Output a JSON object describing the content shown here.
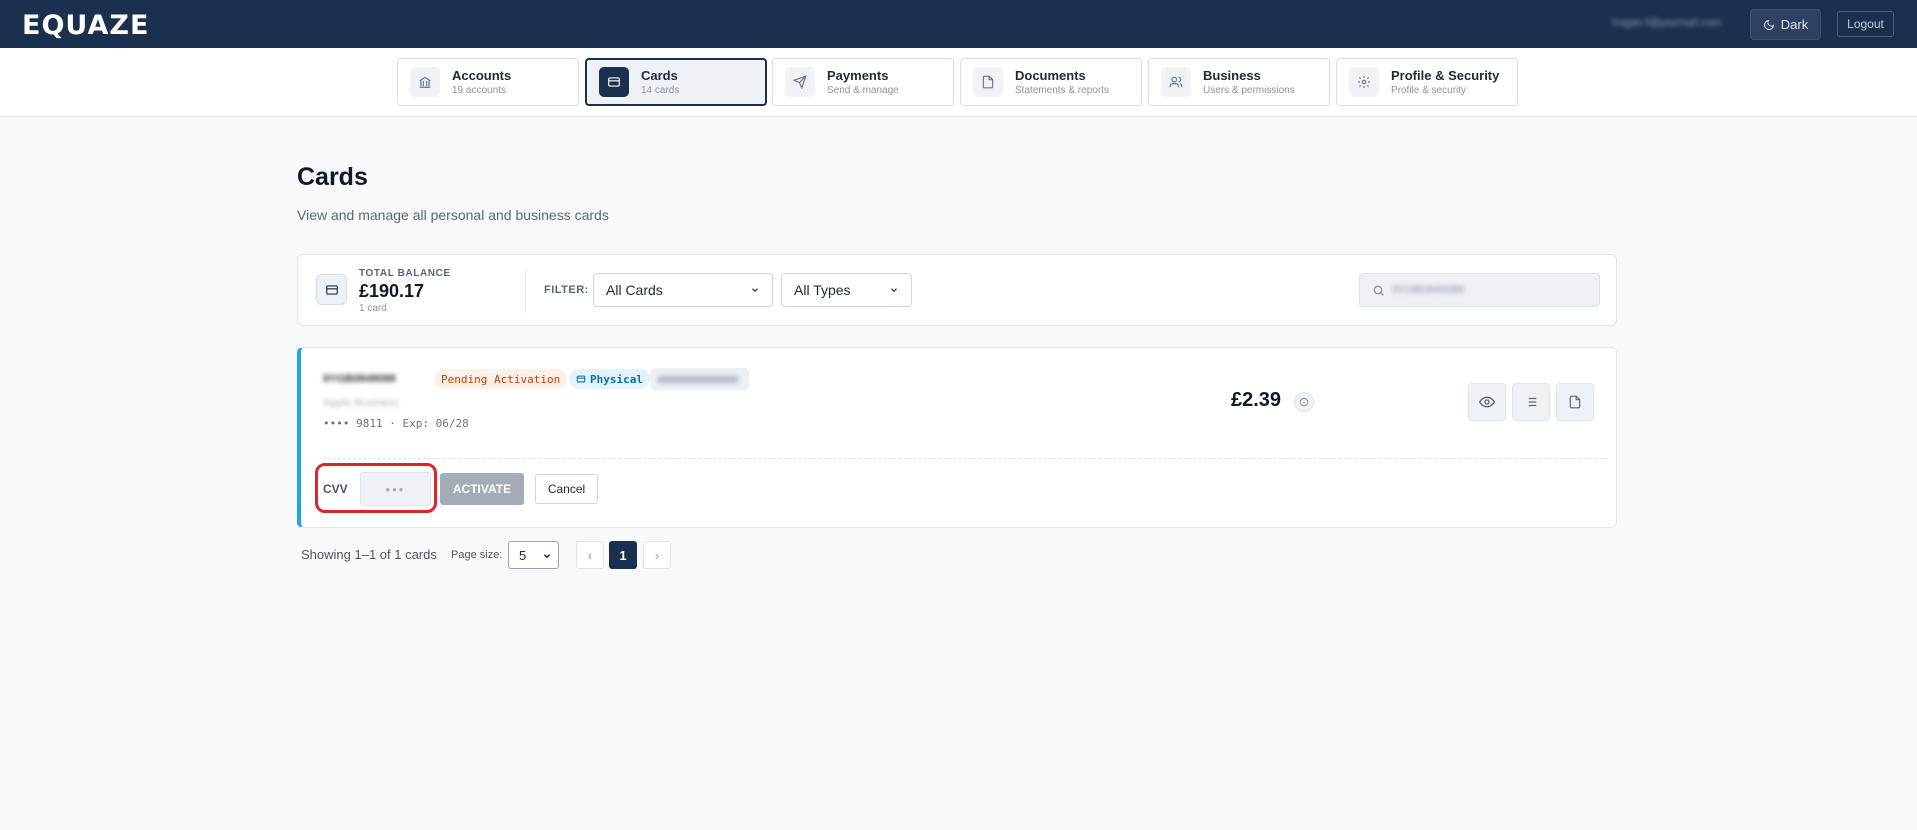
{
  "header": {
    "logo": "EQUAZE",
    "user_email": "hogan.f@pazmail.com",
    "dark_label": "Dark",
    "logout_label": "Logout"
  },
  "nav": [
    {
      "title": "Accounts",
      "sub": "19 accounts",
      "icon": "bank-icon"
    },
    {
      "title": "Cards",
      "sub": "14 cards",
      "icon": "card-icon",
      "active": true
    },
    {
      "title": "Payments",
      "sub": "Send & manage",
      "icon": "send-icon"
    },
    {
      "title": "Documents",
      "sub": "Statements & reports",
      "icon": "document-icon"
    },
    {
      "title": "Business",
      "sub": "Users & permissions",
      "icon": "users-icon"
    },
    {
      "title": "Profile & Security",
      "sub": "Profile & security",
      "icon": "gear-icon"
    }
  ],
  "page": {
    "title": "Cards",
    "subtitle": "View and manage all personal and business cards"
  },
  "balance": {
    "label": "TOTAL BALANCE",
    "amount": "£190.17",
    "count": "1 card"
  },
  "filter": {
    "label": "FILTER:",
    "cards_value": "All Cards",
    "types_value": "All Types",
    "search_value": "9YGB0849088"
  },
  "card": {
    "name": "9YGB0849088",
    "status_badge": "Pending Activation",
    "type_badge": "Physical",
    "holder": "Apple Business",
    "number_line": "•••• 9811 · Exp: 06/28",
    "amount": "£2.39",
    "cvv_label": "CVV",
    "cvv_placeholder": "•••",
    "activate_label": "ACTIVATE",
    "cancel_label": "Cancel"
  },
  "pagination": {
    "showing": "Showing 1–1 of 1 cards",
    "page_size_label": "Page size:",
    "page_size": "5",
    "prev": "‹",
    "current": "1",
    "next": "›"
  },
  "colors": {
    "brand": "#1b2f4e",
    "accent": "#20a4e6",
    "pending": "#c2410c",
    "highlight": "#dc2626"
  }
}
